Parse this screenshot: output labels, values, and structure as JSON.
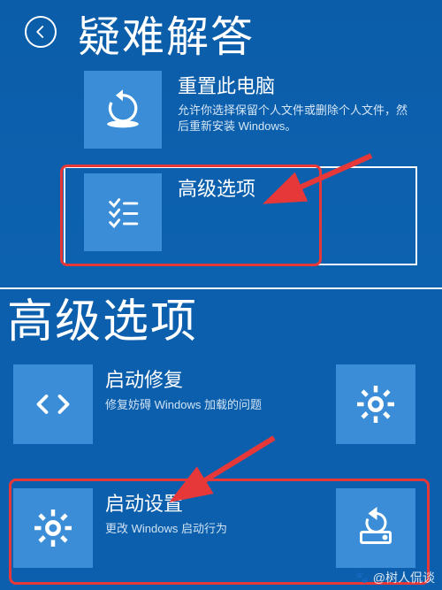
{
  "top": {
    "title": "疑难解答",
    "options": [
      {
        "title": "重置此电脑",
        "desc": "允许你选择保留个人文件或删除个人文件，然后重新安装 Windows。"
      },
      {
        "title": "高级选项",
        "desc": ""
      }
    ]
  },
  "bottom": {
    "title": "高级选项",
    "options": [
      {
        "title": "启动修复",
        "desc": "修复妨碍 Windows 加载的问题"
      },
      {
        "title": "启动设置",
        "desc": "更改 Windows 启动行为"
      }
    ]
  },
  "watermark": "@树人侃谈"
}
